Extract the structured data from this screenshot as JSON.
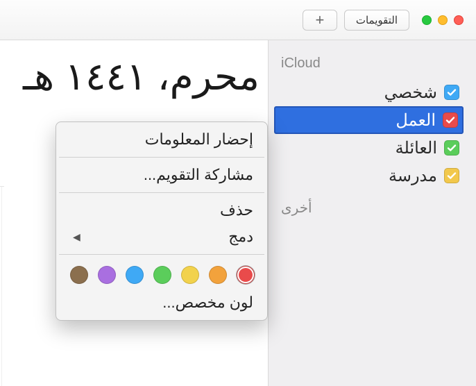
{
  "titlebar": {
    "calendars_btn": "التقويمات",
    "add_btn": "+"
  },
  "sidebar": {
    "group_icloud": "iCloud",
    "group_other": "أخرى",
    "items": [
      {
        "label": "شخصي",
        "color": "#3fa9f5",
        "selected": false
      },
      {
        "label": "العمل",
        "color": "#e94b4b",
        "selected": true
      },
      {
        "label": "العائلة",
        "color": "#5bcd5b",
        "selected": false
      },
      {
        "label": "مدرسة",
        "color": "#f2c84c",
        "selected": false
      }
    ]
  },
  "main": {
    "title": "محرم، ١٤٤١ هـ"
  },
  "menu": {
    "get_info": "إحضار المعلومات",
    "share": "مشاركة التقويم...",
    "delete": "حذف",
    "merge": "دمج",
    "custom_color": "لون مخصص...",
    "colors": [
      {
        "hex": "#e94b4b",
        "selected": true
      },
      {
        "hex": "#f2a23c",
        "selected": false
      },
      {
        "hex": "#f2d24c",
        "selected": false
      },
      {
        "hex": "#5bcd5b",
        "selected": false
      },
      {
        "hex": "#3fa9f5",
        "selected": false
      },
      {
        "hex": "#a96fe0",
        "selected": false
      },
      {
        "hex": "#8b6f4e",
        "selected": false
      }
    ]
  }
}
